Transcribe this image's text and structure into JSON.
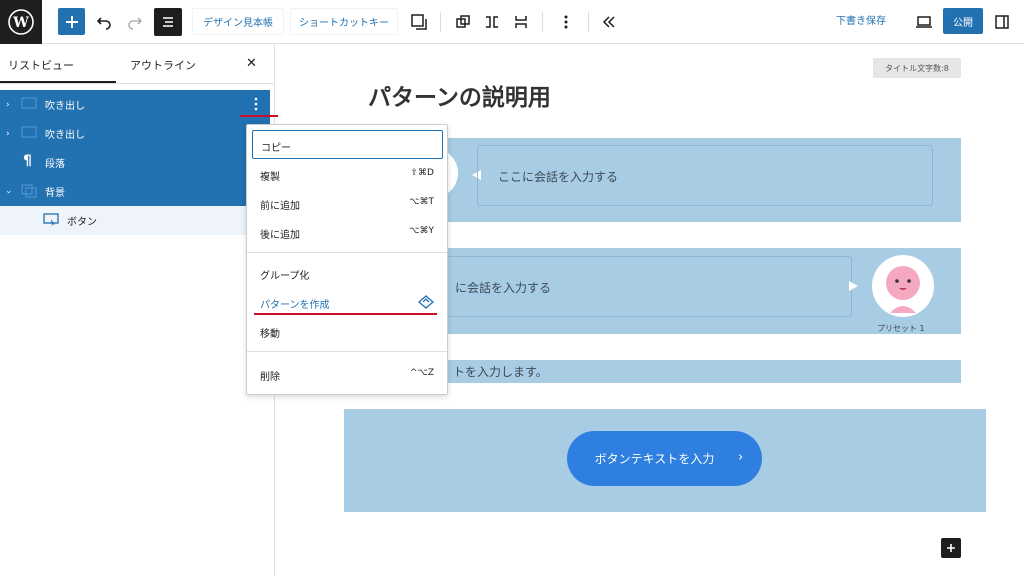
{
  "toolbar": {
    "design_label": "デザイン見本帳",
    "shortcut_label": "ショートカットキー",
    "save_draft_label": "下書き保存",
    "publish_label": "公開"
  },
  "sidebar": {
    "tab_list": "リストビュー",
    "tab_outline": "アウトライン",
    "close_symbol": "✕",
    "items": [
      {
        "label": "吹き出し",
        "selected": true
      },
      {
        "label": "吹き出し",
        "selected": true
      },
      {
        "label": "段落",
        "selected": true
      },
      {
        "label": "背景",
        "selected": true
      },
      {
        "label": "ボタン",
        "selected": false
      }
    ]
  },
  "context_menu": {
    "copy": "コピー",
    "duplicate": "複製",
    "duplicate_key": "⇧⌘D",
    "insert_before": "前に追加",
    "insert_before_key": "⌥⌘T",
    "insert_after": "後に追加",
    "insert_after_key": "⌥⌘Y",
    "group": "グループ化",
    "create_pattern": "パターンを作成",
    "move": "移動",
    "delete": "削除",
    "delete_key": "^⌥Z"
  },
  "canvas": {
    "title_count": "タイトル文字数:8",
    "page_title": "パターンの説明用",
    "bubble1_text": "ここに会話を入力する",
    "bubble2_text": "に会話を入力する",
    "preset_label": "プリセット 1",
    "paragraph_text": "トを入力します。",
    "button_text": "ボタンテキストを入力",
    "button_arrow": "›"
  },
  "colors": {
    "accent": "#2271b1",
    "block_bg": "#a8cce3",
    "cta_button": "#2f7fe0",
    "highlight_red": "#c8102e"
  }
}
